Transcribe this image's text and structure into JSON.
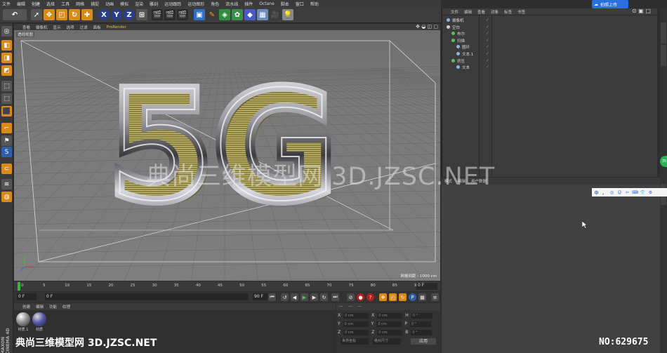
{
  "menu": [
    "文件",
    "编辑",
    "创建",
    "选择",
    "工具",
    "网格",
    "捕捉",
    "动画",
    "模拟",
    "渲染",
    "雕刻",
    "运动跟踪",
    "运动图形",
    "角色",
    "流水线",
    "插件",
    "Octane",
    "脚本",
    "窗口",
    "帮助"
  ],
  "toolbar": {
    "axis_labels": [
      "X",
      "Y",
      "Z"
    ],
    "icons": [
      "undo-icon",
      "select-arrow-icon",
      "move-icon",
      "scale-icon",
      "rotate-icon",
      "add-icon",
      "axis-x-icon",
      "axis-y-icon",
      "axis-z-icon",
      "world-coord-icon",
      "render-view-icon",
      "render-picture-icon",
      "render-settings-icon",
      "cube-icon",
      "pen-icon",
      "subdivide-icon",
      "array-icon",
      "deformer-icon",
      "floor-icon",
      "camera-icon",
      "light-icon"
    ]
  },
  "viewport": {
    "menu": [
      "查看",
      "摄像机",
      "显示",
      "选项",
      "过滤",
      "面板",
      "ProRender"
    ],
    "label": "透视视图",
    "grid_info": "网格间距 : 1000 cm",
    "model_text": "5G",
    "colors": {
      "bg": "#787878",
      "grid": "#6a6a6a",
      "safe_frame": "#d8d8d8",
      "chrome_light": "#e8e8f0",
      "chrome_dark": "#3a3a3a",
      "gold": "#a89a4a"
    }
  },
  "timeline": {
    "ticks": [
      "0",
      "5",
      "10",
      "15",
      "20",
      "25",
      "30",
      "35",
      "40",
      "45",
      "50",
      "55",
      "60",
      "65",
      "70",
      "75",
      "80",
      "85",
      "90"
    ],
    "current_frame": "0 F",
    "start": "0 F",
    "range_start": "0 F",
    "range_end": "90 F",
    "end": "90 F"
  },
  "materials": {
    "menu": [
      "创建",
      "编辑",
      "功能",
      "纹理"
    ],
    "items": [
      {
        "label": "材质.1",
        "color": "#9a9a9a"
      },
      {
        "label": "材质",
        "color": "#5a5aa8"
      }
    ]
  },
  "coords": {
    "header": "— — —",
    "rows": [
      {
        "axis": "X",
        "pos": "0 cm",
        "axis2": "X",
        "size": "0 cm",
        "axis3": "H",
        "rot": "0 °"
      },
      {
        "axis": "Y",
        "pos": "0 cm",
        "axis2": "Y",
        "size": "0 cm",
        "axis3": "P",
        "rot": "0 °"
      },
      {
        "axis": "Z",
        "pos": "0 cm",
        "axis2": "Z",
        "size": "0 cm",
        "axis3": "B",
        "rot": "0 °"
      }
    ],
    "mode": "世界坐标",
    "scale": "绝对尺寸",
    "apply": "应用"
  },
  "objects": {
    "menu": [
      "文件",
      "编辑",
      "查看",
      "对象",
      "标签",
      "书签"
    ],
    "items": [
      {
        "name": "摄像机",
        "indent": 0,
        "color": "#8fb4e0"
      },
      {
        "name": "空白",
        "indent": 0,
        "color": "#cfcfcf"
      },
      {
        "name": "布尔",
        "indent": 1,
        "color": "#58c058"
      },
      {
        "name": "扫描",
        "indent": 1,
        "color": "#58c058"
      },
      {
        "name": "圆环",
        "indent": 2,
        "color": "#8fb4e0"
      },
      {
        "name": "文本.1",
        "indent": 2,
        "color": "#8fb4e0"
      },
      {
        "name": "挤压",
        "indent": 1,
        "color": "#58c058"
      },
      {
        "name": "文本",
        "indent": 2,
        "color": "#8fb4e0"
      }
    ]
  },
  "attributes": {
    "tabs": [
      "模式",
      "编辑",
      "用户数据"
    ]
  },
  "overlay": {
    "upload_label": "拍照上传",
    "ime_items": [
      "中",
      "，",
      "◎",
      "☺",
      "✂",
      "⌨",
      "👕",
      "⚙"
    ],
    "side_badge": "35",
    "watermark_center": "典尚三维模型网 3D.JZSC.NET",
    "watermark_bottom": "典尚三维模型网 3D.JZSC.NET",
    "watermark_no": "NO:629675",
    "maxon_label": "MAXON CINEMA 4D"
  }
}
